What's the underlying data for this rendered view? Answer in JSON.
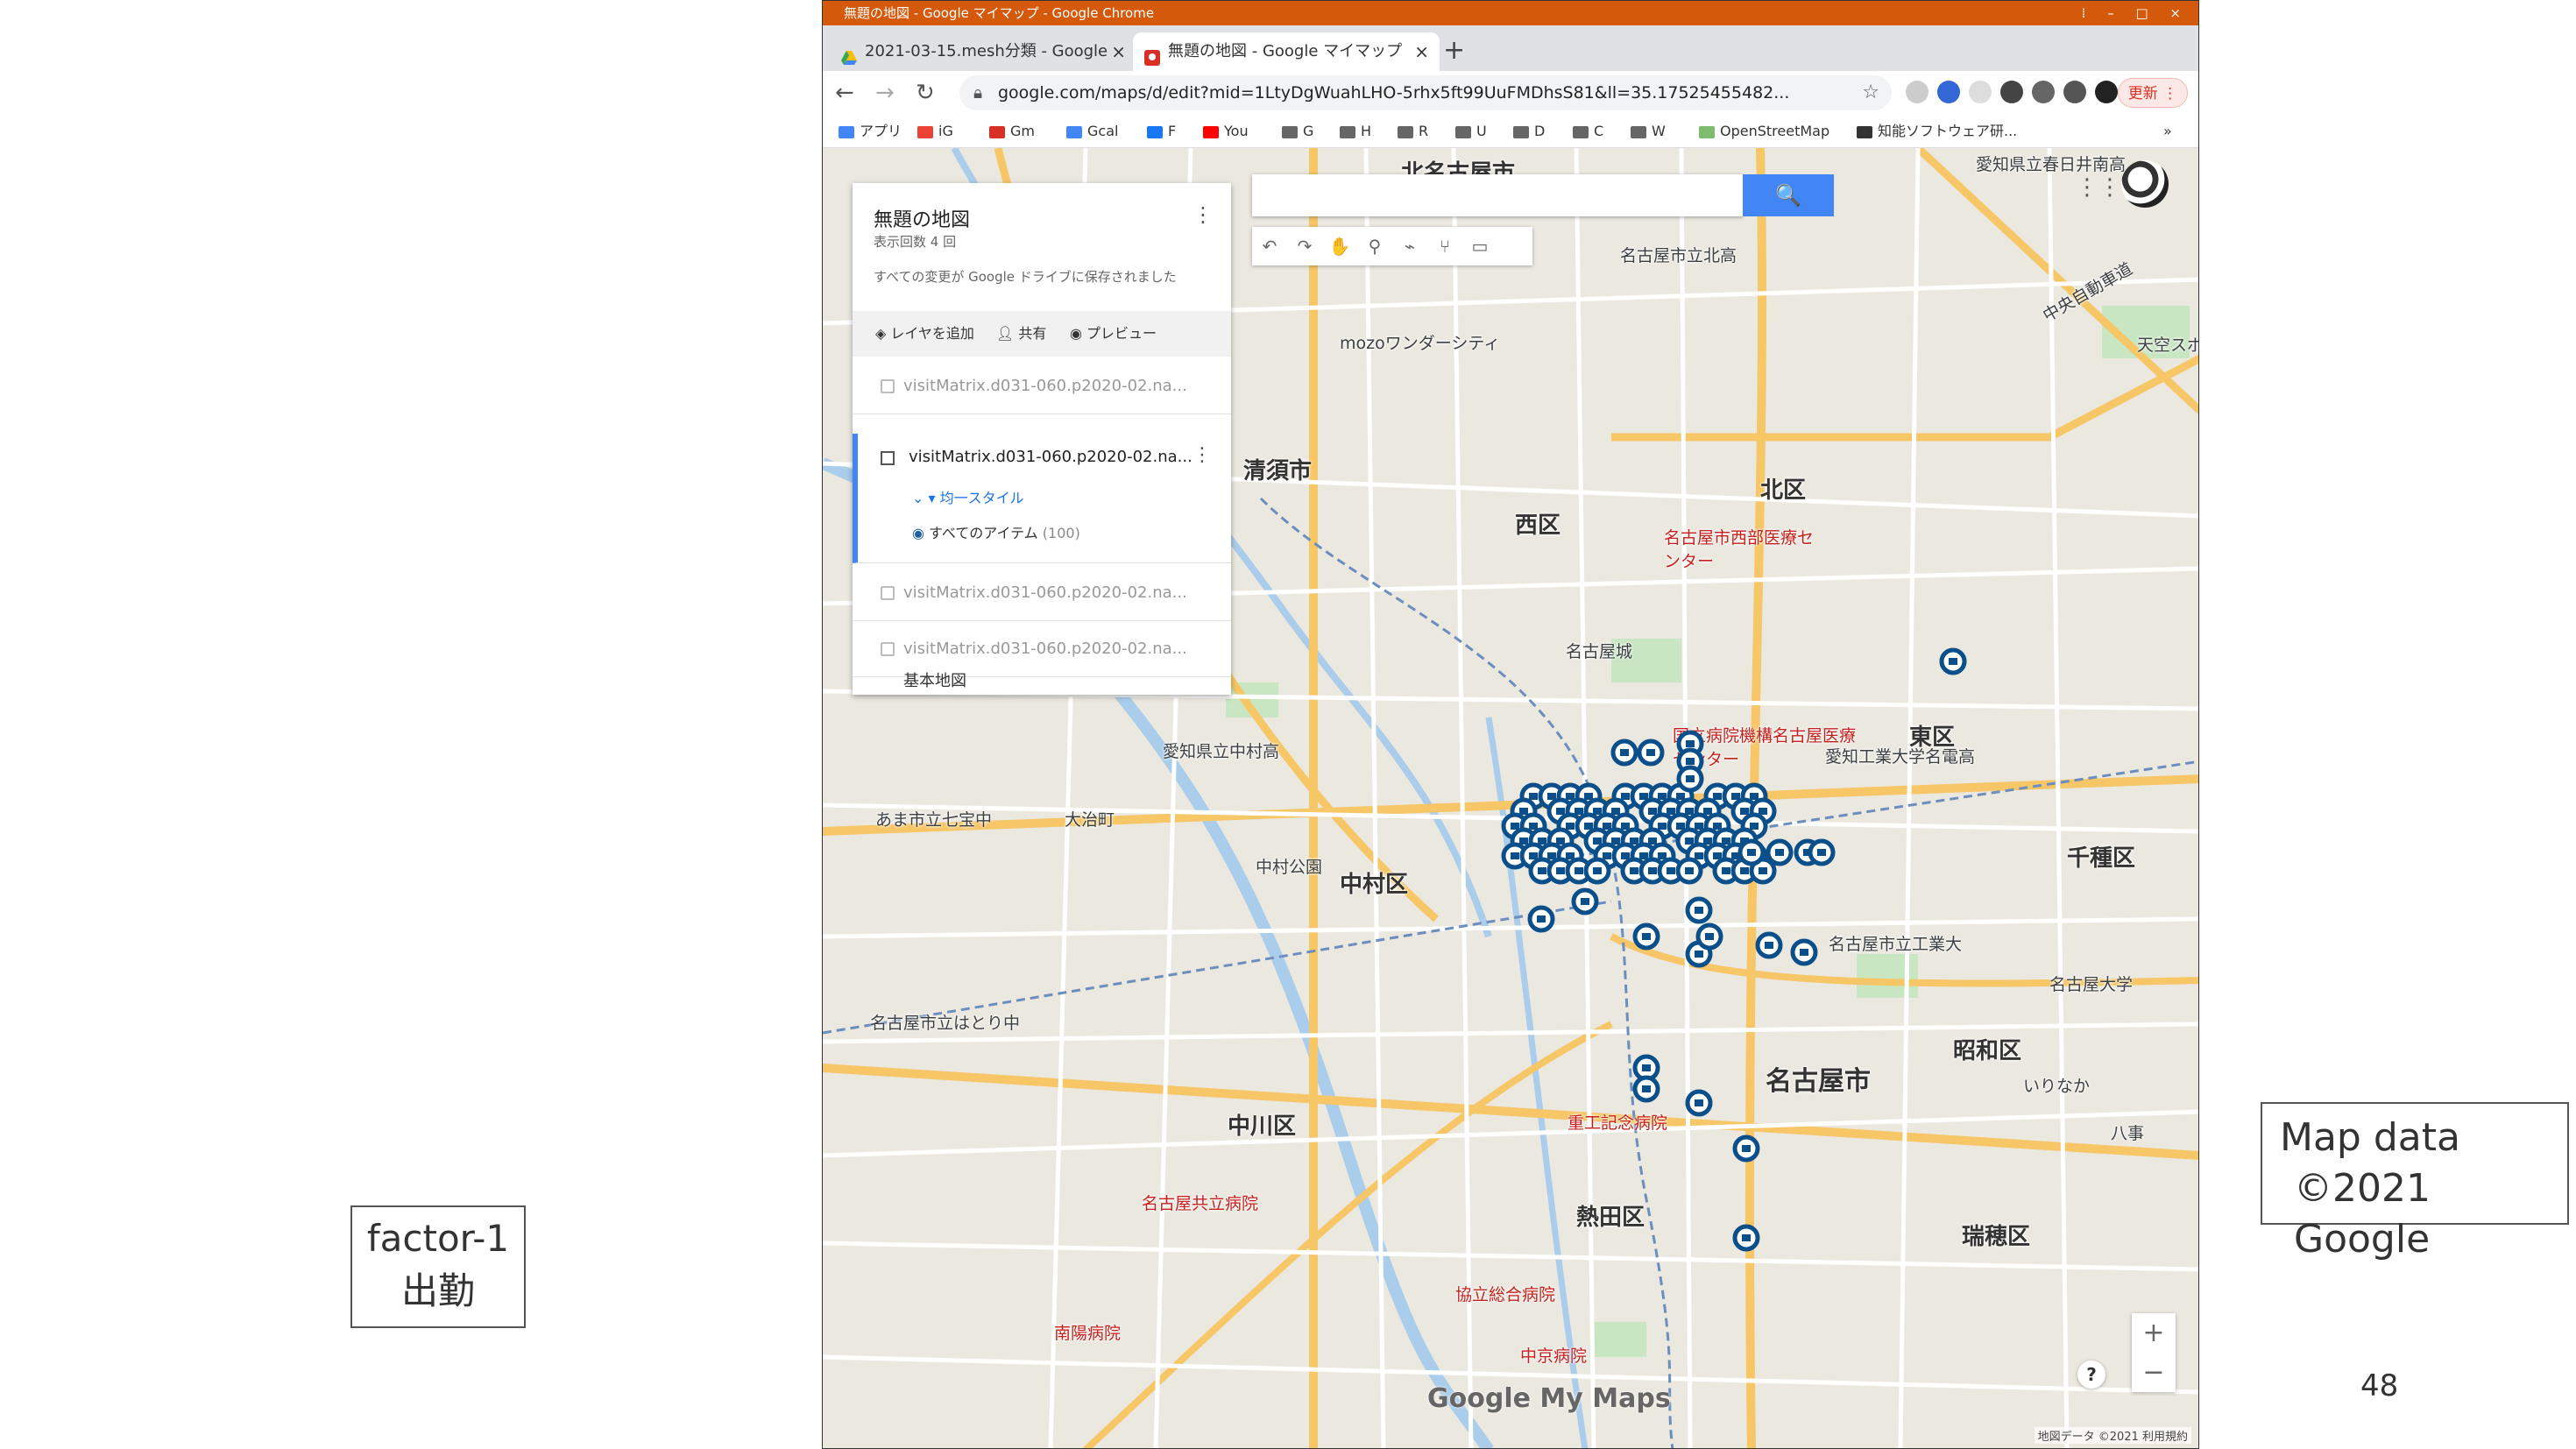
{
  "browser": {
    "window_title": "無題の地図 - Google マイマップ - Google Chrome",
    "window_controls": "⁞  –  □  ×",
    "tabs": [
      {
        "label": "2021-03-15.mesh分類 - Google",
        "active": false
      },
      {
        "label": "無題の地図 - Google マイマップ",
        "active": true
      }
    ],
    "url": "google.com/maps/d/edit?mid=1LtyDgWuahLHO-5rhx5ft99UuFMDhsS81&ll=35.17525455482...",
    "update_label": "更新 ⋮",
    "bookmarks": [
      "アプリ",
      "iG",
      "Gm",
      "Gcal",
      "F",
      "You",
      "G",
      "H",
      "R",
      "U",
      "D",
      "C",
      "W",
      "OpenStreetMap",
      "知能ソフトウェア研...",
      "»"
    ]
  },
  "mymaps": {
    "title": "無題の地図",
    "views": "表示回数 4 回",
    "saved": "すべての変更が Google ドライブに保存されました",
    "actions": [
      "レイヤを追加",
      "共有",
      "プレビュー"
    ],
    "layers": [
      {
        "label": "visitMatrix.d031-060.p2020-02.na...",
        "checked": false
      },
      {
        "label": "visitMatrix.d031-060.p2020-02.na...",
        "checked": true
      },
      {
        "label": "visitMatrix.d031-060.p2020-02.na...",
        "checked": false
      },
      {
        "label": "visitMatrix.d031-060.p2020-02.na...",
        "checked": false
      }
    ],
    "active_layer": {
      "label": "visitMatrix.d031-060.p2020-02.na...",
      "style": "均一スタイル",
      "items": "すべてのアイテム",
      "count": "(100)"
    },
    "basemap": "基本地図"
  },
  "map": {
    "labels": [
      {
        "text": "北名古屋市",
        "cls": "big"
      },
      {
        "text": "清須市",
        "cls": "big"
      },
      {
        "text": "西区",
        "cls": "big"
      },
      {
        "text": "北区",
        "cls": "big"
      },
      {
        "text": "東区",
        "cls": "big"
      },
      {
        "text": "中村区",
        "cls": "big"
      },
      {
        "text": "千種区",
        "cls": "big"
      },
      {
        "text": "中川区",
        "cls": "big"
      },
      {
        "text": "名古屋市",
        "cls": "big"
      },
      {
        "text": "昭和区",
        "cls": "big"
      },
      {
        "text": "熱田区",
        "cls": "big"
      },
      {
        "text": "瑞穂区",
        "cls": "big"
      },
      {
        "text": "名古屋城",
        "cls": ""
      },
      {
        "text": "名古屋市西部医療センター",
        "cls": "red"
      },
      {
        "text": "国立病院機構名古屋医療センター",
        "cls": "red"
      },
      {
        "text": "重工記念病院",
        "cls": "red"
      },
      {
        "text": "名古屋共立病院",
        "cls": "red"
      },
      {
        "text": "協立総合病院",
        "cls": "red"
      },
      {
        "text": "中京病院",
        "cls": "red"
      },
      {
        "text": "南陽病院",
        "cls": "red"
      },
      {
        "text": "愛知県立中村高",
        "cls": ""
      },
      {
        "text": "大治町",
        "cls": ""
      },
      {
        "text": "あま市立七宝中",
        "cls": ""
      },
      {
        "text": "中村公園",
        "cls": ""
      },
      {
        "text": "名古屋市立はとり中",
        "cls": ""
      },
      {
        "text": "名古屋市立工業大",
        "cls": ""
      },
      {
        "text": "愛知工業大学名電高",
        "cls": ""
      },
      {
        "text": "mozoワンダーシティ",
        "cls": ""
      },
      {
        "text": "名古屋市立北高",
        "cls": ""
      },
      {
        "text": "愛知県立春日井南高",
        "cls": ""
      },
      {
        "text": "中央自動車道",
        "cls": ""
      },
      {
        "text": "天空スポ",
        "cls": ""
      },
      {
        "text": "名古屋大学",
        "cls": ""
      },
      {
        "text": "いりなか",
        "cls": ""
      },
      {
        "text": "八事",
        "cls": ""
      }
    ],
    "search_button": "🔍",
    "tools": [
      "↶",
      "↷",
      "✋",
      "⚲",
      "⌁",
      "⑂",
      "▭"
    ],
    "zoom_in": "+",
    "zoom_out": "−",
    "help": "?",
    "logo": "Google My Maps",
    "footer": "地図データ ©2021   利用規約"
  },
  "slide": {
    "factor_line1": "factor-1",
    "factor_line2": "出勤",
    "credit_line1": "Map data",
    "credit_line2": "©2021 Google",
    "page_number": "48"
  }
}
